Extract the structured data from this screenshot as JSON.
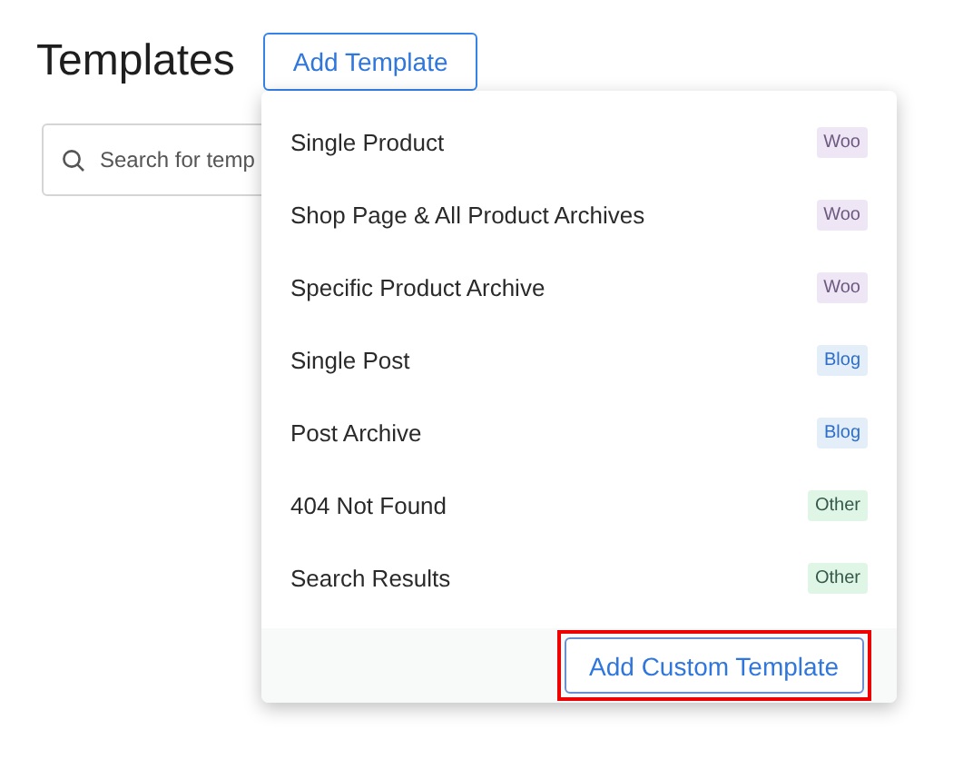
{
  "title": "Templates",
  "add_button": "Add Template",
  "search": {
    "placeholder": "Search for temp"
  },
  "menu": {
    "items": [
      {
        "label": "Single Product",
        "tag": "Woo",
        "kind": "woo"
      },
      {
        "label": "Shop Page & All Product Archives",
        "tag": "Woo",
        "kind": "woo"
      },
      {
        "label": "Specific Product Archive",
        "tag": "Woo",
        "kind": "woo"
      },
      {
        "label": "Single Post",
        "tag": "Blog",
        "kind": "blog"
      },
      {
        "label": "Post Archive",
        "tag": "Blog",
        "kind": "blog"
      },
      {
        "label": "404 Not Found",
        "tag": "Other",
        "kind": "other"
      },
      {
        "label": "Search Results",
        "tag": "Other",
        "kind": "other"
      }
    ],
    "footer_button": {
      "label": "Add Custom Template",
      "highlighted": true
    }
  }
}
